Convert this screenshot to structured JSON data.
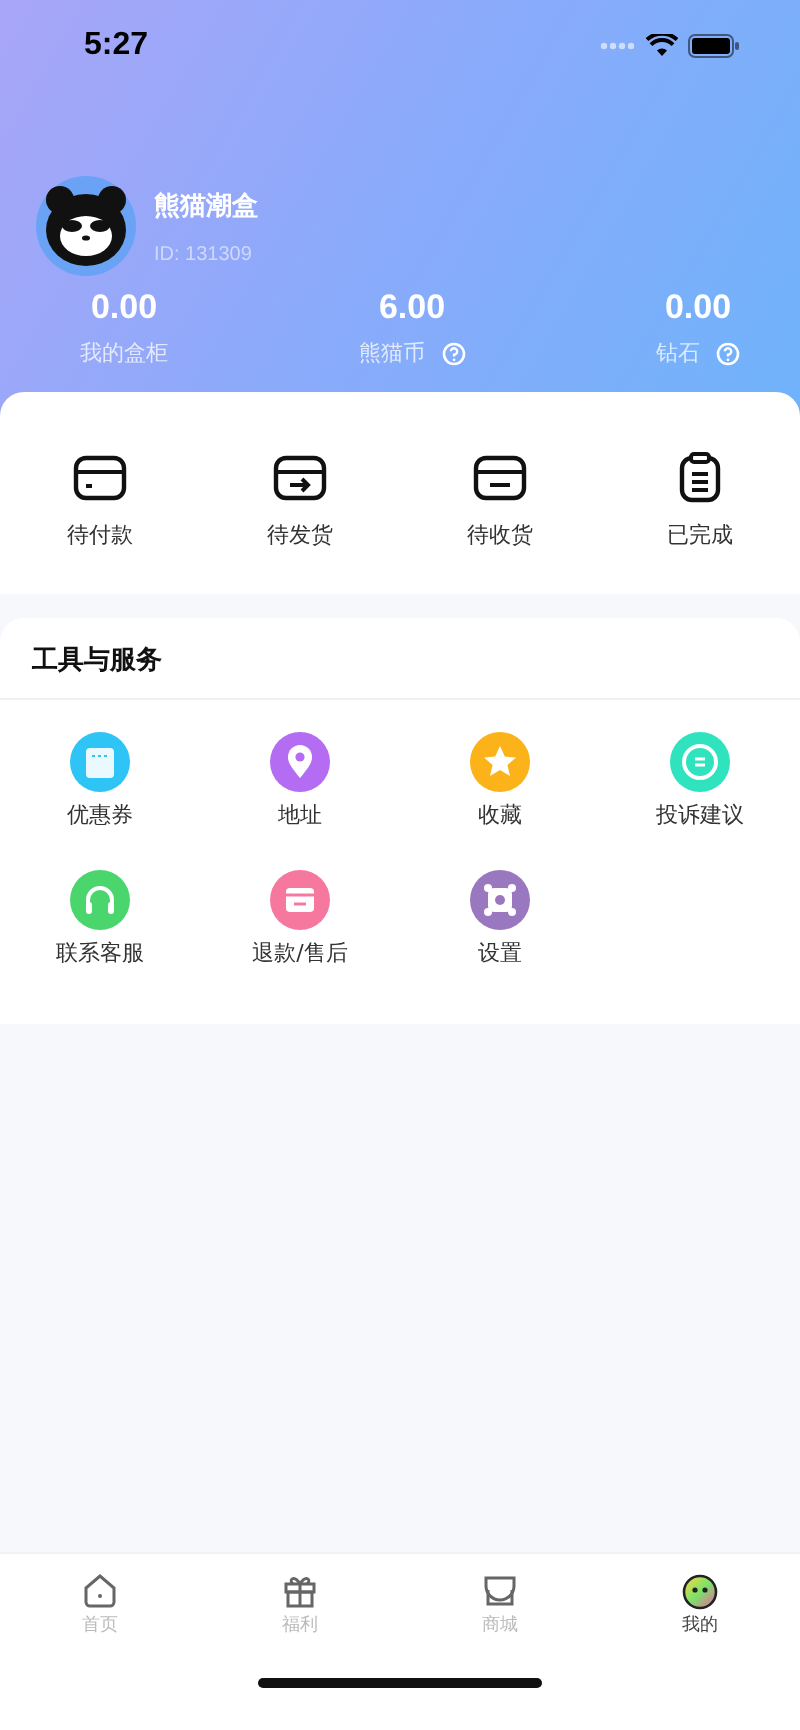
{
  "status_bar": {
    "time": "5:27"
  },
  "profile": {
    "name": "熊猫潮盒",
    "id": "ID: 131309"
  },
  "stats": [
    {
      "value": "0.00",
      "label": "我的盒柜",
      "help": false
    },
    {
      "value": "6.00",
      "label": "熊猫币",
      "help": true
    },
    {
      "value": "0.00",
      "label": "钻石",
      "help": true
    }
  ],
  "orders": [
    {
      "kind": "pay",
      "label": "待付款"
    },
    {
      "kind": "ship",
      "label": "待发货"
    },
    {
      "kind": "receive",
      "label": "待收货"
    },
    {
      "kind": "done",
      "label": "已完成"
    }
  ],
  "tools": {
    "title": "工具与服务",
    "items": [
      {
        "kind": "coupon",
        "label": "优惠券",
        "color": "#2ec4f6"
      },
      {
        "kind": "address",
        "label": "地址",
        "color": "#b46cf2"
      },
      {
        "kind": "favorite",
        "label": "收藏",
        "color": "#fbb319"
      },
      {
        "kind": "feedback",
        "label": "投诉建议",
        "color": "#2fe3bf"
      },
      {
        "kind": "service",
        "label": "联系客服",
        "color": "#4bd66d"
      },
      {
        "kind": "refund",
        "label": "退款/售后",
        "color": "#f6789e"
      },
      {
        "kind": "settings",
        "label": "设置",
        "color": "#9a78c0"
      }
    ]
  },
  "tab_bar": [
    {
      "kind": "home",
      "label": "首页",
      "selected": false
    },
    {
      "kind": "gift",
      "label": "福利",
      "selected": false
    },
    {
      "kind": "shop",
      "label": "商城",
      "selected": false
    },
    {
      "kind": "me",
      "label": "我的",
      "selected": true
    }
  ]
}
